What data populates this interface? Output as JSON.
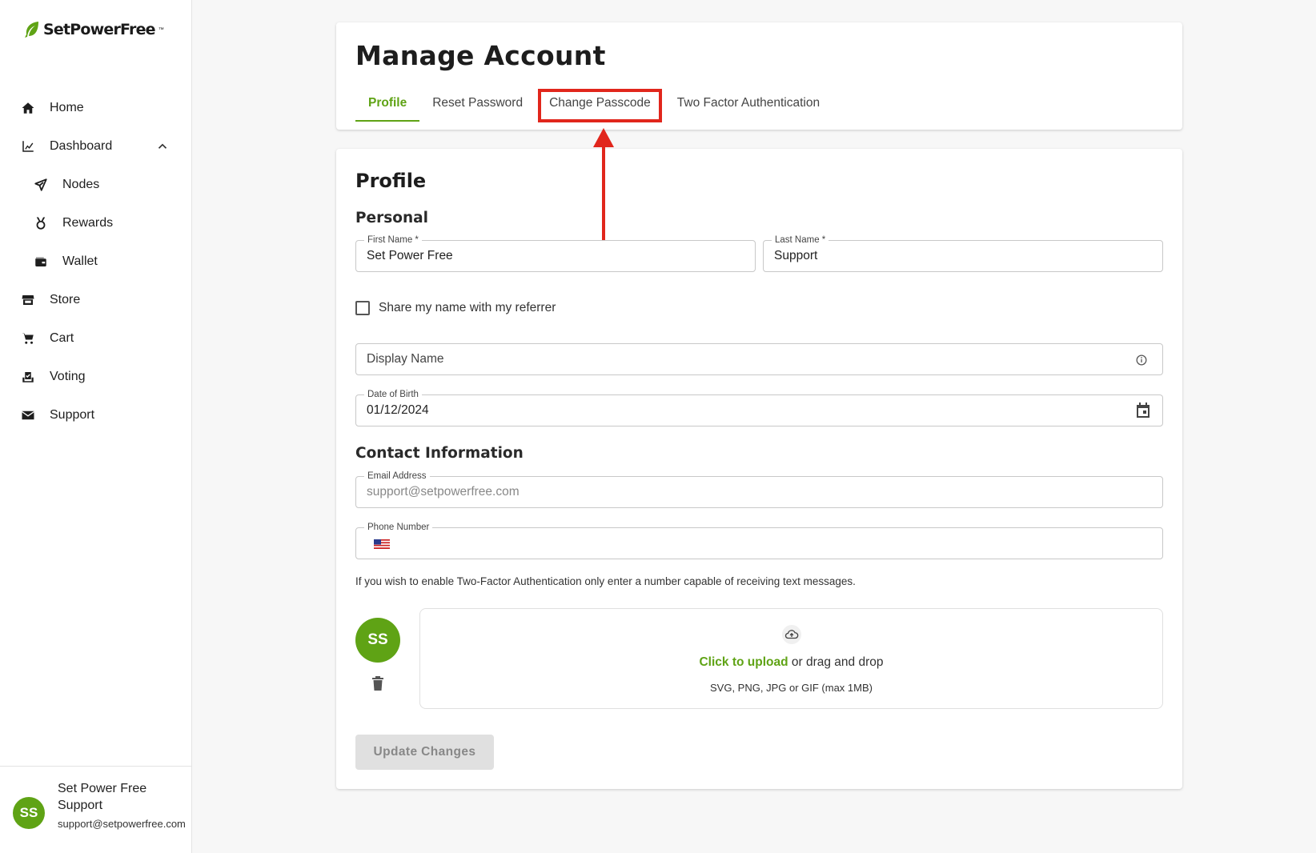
{
  "brand": {
    "name": "SetPowerFree",
    "trademark": "™",
    "accent": "#5fa315"
  },
  "sidebar": {
    "items": [
      {
        "label": "Home",
        "icon": "home-icon"
      },
      {
        "label": "Dashboard",
        "icon": "chart-line-icon",
        "expanded": true
      },
      {
        "label": "Nodes",
        "icon": "send-icon",
        "sub": true
      },
      {
        "label": "Rewards",
        "icon": "medal-icon",
        "sub": true
      },
      {
        "label": "Wallet",
        "icon": "wallet-icon",
        "sub": true
      },
      {
        "label": "Store",
        "icon": "store-icon"
      },
      {
        "label": "Cart",
        "icon": "cart-icon"
      },
      {
        "label": "Voting",
        "icon": "vote-icon"
      },
      {
        "label": "Support",
        "icon": "mail-icon"
      }
    ],
    "user": {
      "initials": "SS",
      "name": "Set Power Free Support",
      "email": "support@setpowerfree.com"
    }
  },
  "header": {
    "title": "Manage Account",
    "tabs": [
      {
        "label": "Profile",
        "active": true
      },
      {
        "label": "Reset Password"
      },
      {
        "label": "Change Passcode",
        "highlighted": true
      },
      {
        "label": "Two Factor Authentication"
      }
    ]
  },
  "profile": {
    "title": "Profile",
    "personal_heading": "Personal",
    "first_name": {
      "label": "First Name *",
      "value": "Set Power Free"
    },
    "last_name": {
      "label": "Last Name *",
      "value": "Support"
    },
    "share_name_label": "Share my name with my referrer",
    "display_name": {
      "placeholder": "Display Name"
    },
    "dob": {
      "label": "Date of Birth",
      "value": "01/12/2024"
    },
    "contact_heading": "Contact Information",
    "email": {
      "label": "Email Address",
      "value": "support@setpowerfree.com"
    },
    "phone": {
      "label": "Phone Number",
      "value": ""
    },
    "help_text": "If you wish to enable Two-Factor Authentication only enter a number capable of receiving text messages.",
    "avatar_initials": "SS",
    "upload": {
      "link": "Click to upload",
      "rest": "or drag and drop",
      "hint": "SVG, PNG, JPG or GIF (max 1MB)"
    },
    "submit_label": "Update Changes"
  },
  "annotation": {
    "color": "#e1261c"
  }
}
